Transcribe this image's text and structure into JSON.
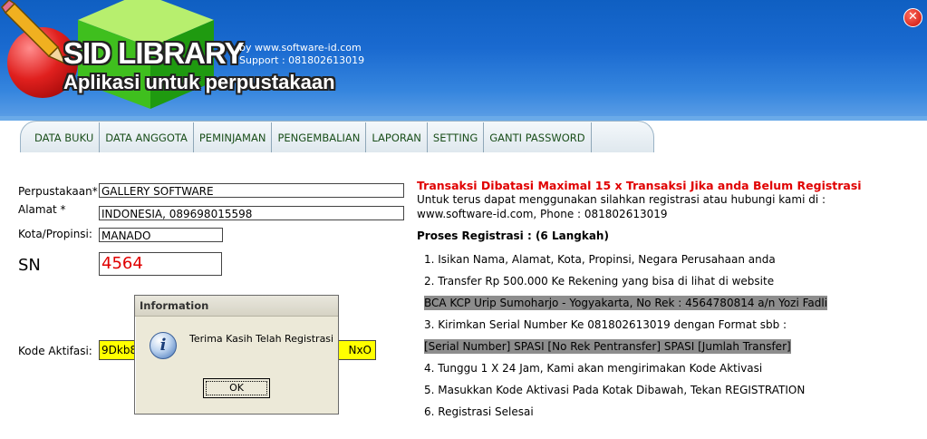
{
  "header": {
    "app_title": "SID LIBRARY",
    "app_subtitle": "Aplikasi untuk perpustakaan",
    "by_line": "by www.software-id.com",
    "support_line": "Support : 081802613019",
    "close_symbol": "✕"
  },
  "tabs": [
    {
      "label": "DATA BUKU"
    },
    {
      "label": "DATA ANGGOTA"
    },
    {
      "label": "PEMINJAMAN"
    },
    {
      "label": "PENGEMBALIAN"
    },
    {
      "label": "LAPORAN"
    },
    {
      "label": "SETTING"
    },
    {
      "label": "GANTI PASSWORD"
    }
  ],
  "form": {
    "perpustakaan_label": "Perpustakaan*",
    "perpustakaan_value": "GALLERY SOFTWARE",
    "alamat_label": "Alamat *",
    "alamat_value": "INDONESIA, 089698015598",
    "kota_label": "Kota/Propinsi:",
    "kota_value": "MANADO",
    "sn_label": "SN",
    "sn_value": "4564",
    "kode_label": "Kode Aktifasi:",
    "kode_value_left": "9Dkb8",
    "kode_value_right": "NxO"
  },
  "info": {
    "title": "Transaksi Dibatasi Maximal 15 x Transaksi Jika anda Belum Registrasi",
    "line1": "Untuk terus dapat menggunakan silahkan registrasi atau hubungi kami di :",
    "line2": "www.software-id.com, Phone : 081802613019",
    "proses_title": "Proses Registrasi : (6 Langkah)",
    "steps": [
      "1. Isikan Nama, Alamat, Kota, Propinsi, Negara Perusahaan anda",
      "2. Transfer Rp 500.000 Ke Rekening yang bisa di lihat di website",
      "BCA KCP Urip Sumoharjo - Yogyakarta, No Rek : 4564780814 a/n Yozi Fadli",
      "3. Kirimkan Serial Number Ke 081802613019 dengan Format sbb :",
      "[Serial Number] SPASI [No Rek Pentransfer] SPASI [Jumlah Transfer]",
      "4. Tunggu 1 X 24 Jam, Kami akan mengirimakan Kode Aktivasi",
      "5. Masukkan Kode Aktivasi Pada Kotak Dibawah, Tekan REGISTRATION",
      "6. Registrasi Selesai"
    ]
  },
  "dialog": {
    "title": "Information",
    "icon_glyph": "i",
    "message": "Terima Kasih Telah Registrasi",
    "ok_label": "OK"
  }
}
